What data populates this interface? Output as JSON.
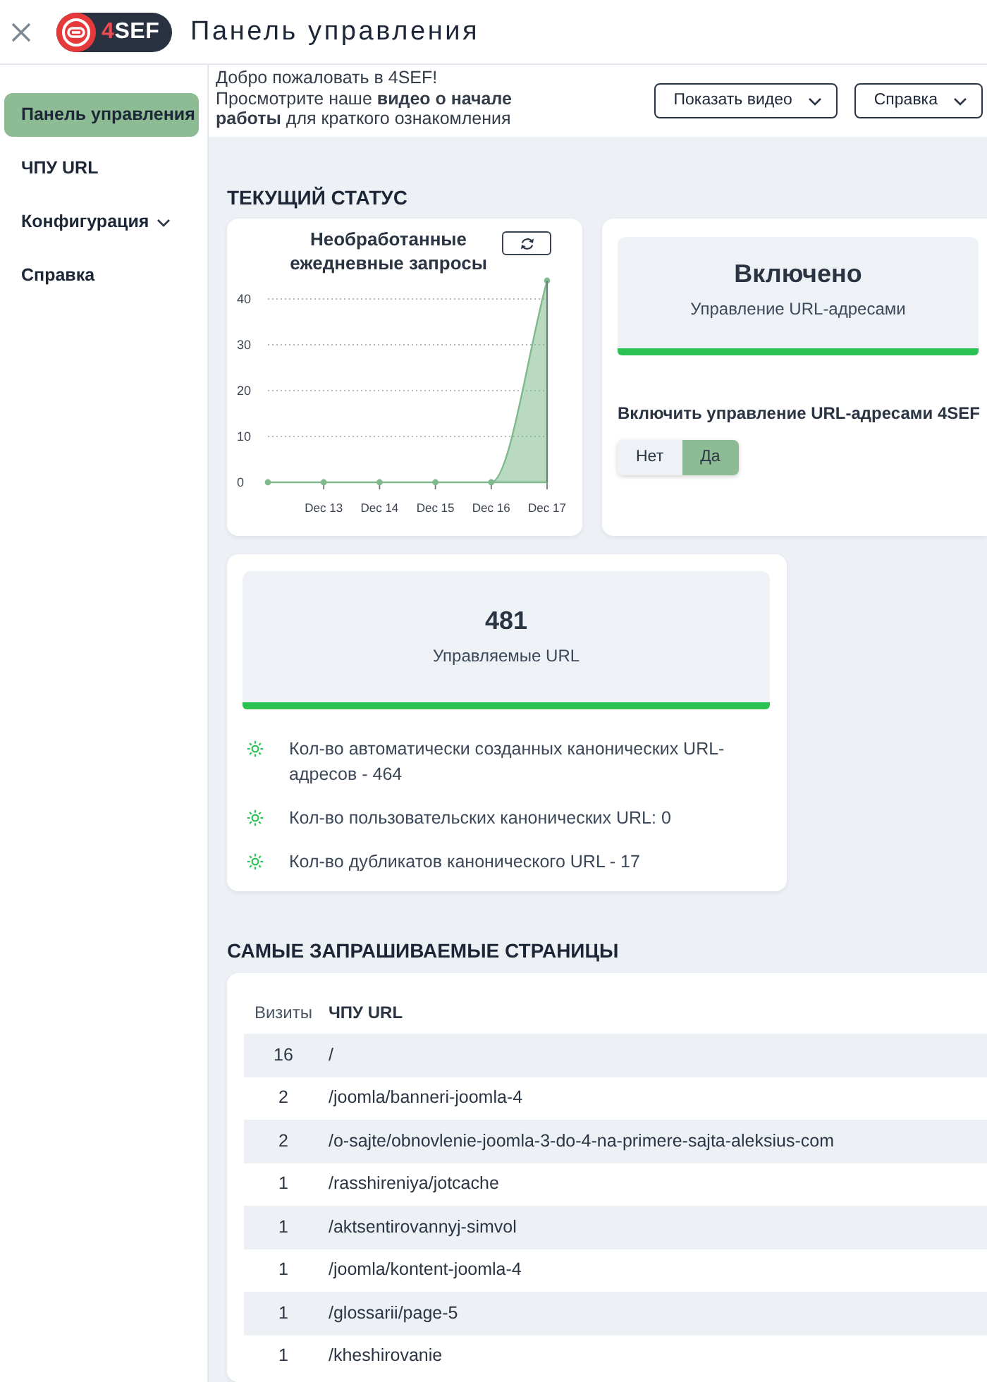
{
  "header": {
    "logo_text": "4SEF",
    "title": "Панель управления"
  },
  "sidebar": {
    "items": [
      {
        "label": "Панель управления",
        "kind": "link",
        "selected": true
      },
      {
        "label": "ЧПУ URL",
        "kind": "link",
        "selected": false
      },
      {
        "label": "Конфигурация",
        "kind": "group",
        "selected": false,
        "expanded": false
      },
      {
        "label": "Справка",
        "kind": "link",
        "selected": false
      }
    ]
  },
  "welcome": {
    "greeting": "Добро пожаловать в 4SEF!",
    "text": "Просмотрите наше **видео о начале работы** для краткого ознакомления",
    "buttons": [
      "Показать видео",
      "Справка"
    ]
  },
  "status": {
    "heading": "ТЕКУЩИЙ СТАТУС",
    "chart_card": {
      "title": "Необработанные ежедневные запросы",
      "chart_data": {
        "type": "area",
        "categories": [
          null,
          "Dec 13",
          "Dec 14",
          "Dec 15",
          "Dec 16",
          "Dec 17"
        ],
        "ylim": [
          0,
          44
        ],
        "yticks": [
          0,
          10,
          20,
          30,
          40
        ],
        "grid": true,
        "series": [
          {
            "color": "#7fb98c",
            "values": [
              0,
              0,
              0,
              0,
              0,
              44
            ]
          }
        ]
      }
    },
    "state_card": {
      "value": "Включено",
      "label": "Управление URL-адресами",
      "switch_label": "Включить управление URL-адресами 4SEF",
      "options": [
        {
          "label": "Нет",
          "selected": false
        },
        {
          "label": "Да",
          "selected": true
        }
      ]
    },
    "urls_card": {
      "value": "481",
      "label": "Управляемые URL",
      "items": [
        "Кол-во автоматически созданных канонических URL-адресов - 464",
        "Кол-во пользовательских канонических URL: 0",
        "Кол-во дубликатов канонического URL - 17"
      ]
    }
  },
  "top_pages": {
    "heading": "САМЫЕ ЗАПРАШИВАЕМЫЕ СТРАНИЦЫ",
    "columns": [
      "Визиты",
      "ЧПУ URL"
    ],
    "rows": [
      [
        "16",
        "/"
      ],
      [
        "2",
        "/joomla/banneri-joomla-4"
      ],
      [
        "2",
        "/o-sajte/obnovlenie-joomla-3-do-4-na-primere-sajta-aleksius-com"
      ],
      [
        "1",
        "/rasshireniya/jotcache"
      ],
      [
        "1",
        "/aktsentirovannyj-simvol"
      ],
      [
        "1",
        "/joomla/kontent-joomla-4"
      ],
      [
        "1",
        "/glossarii/page-5"
      ],
      [
        "1",
        "/kheshirovanie"
      ]
    ]
  }
}
